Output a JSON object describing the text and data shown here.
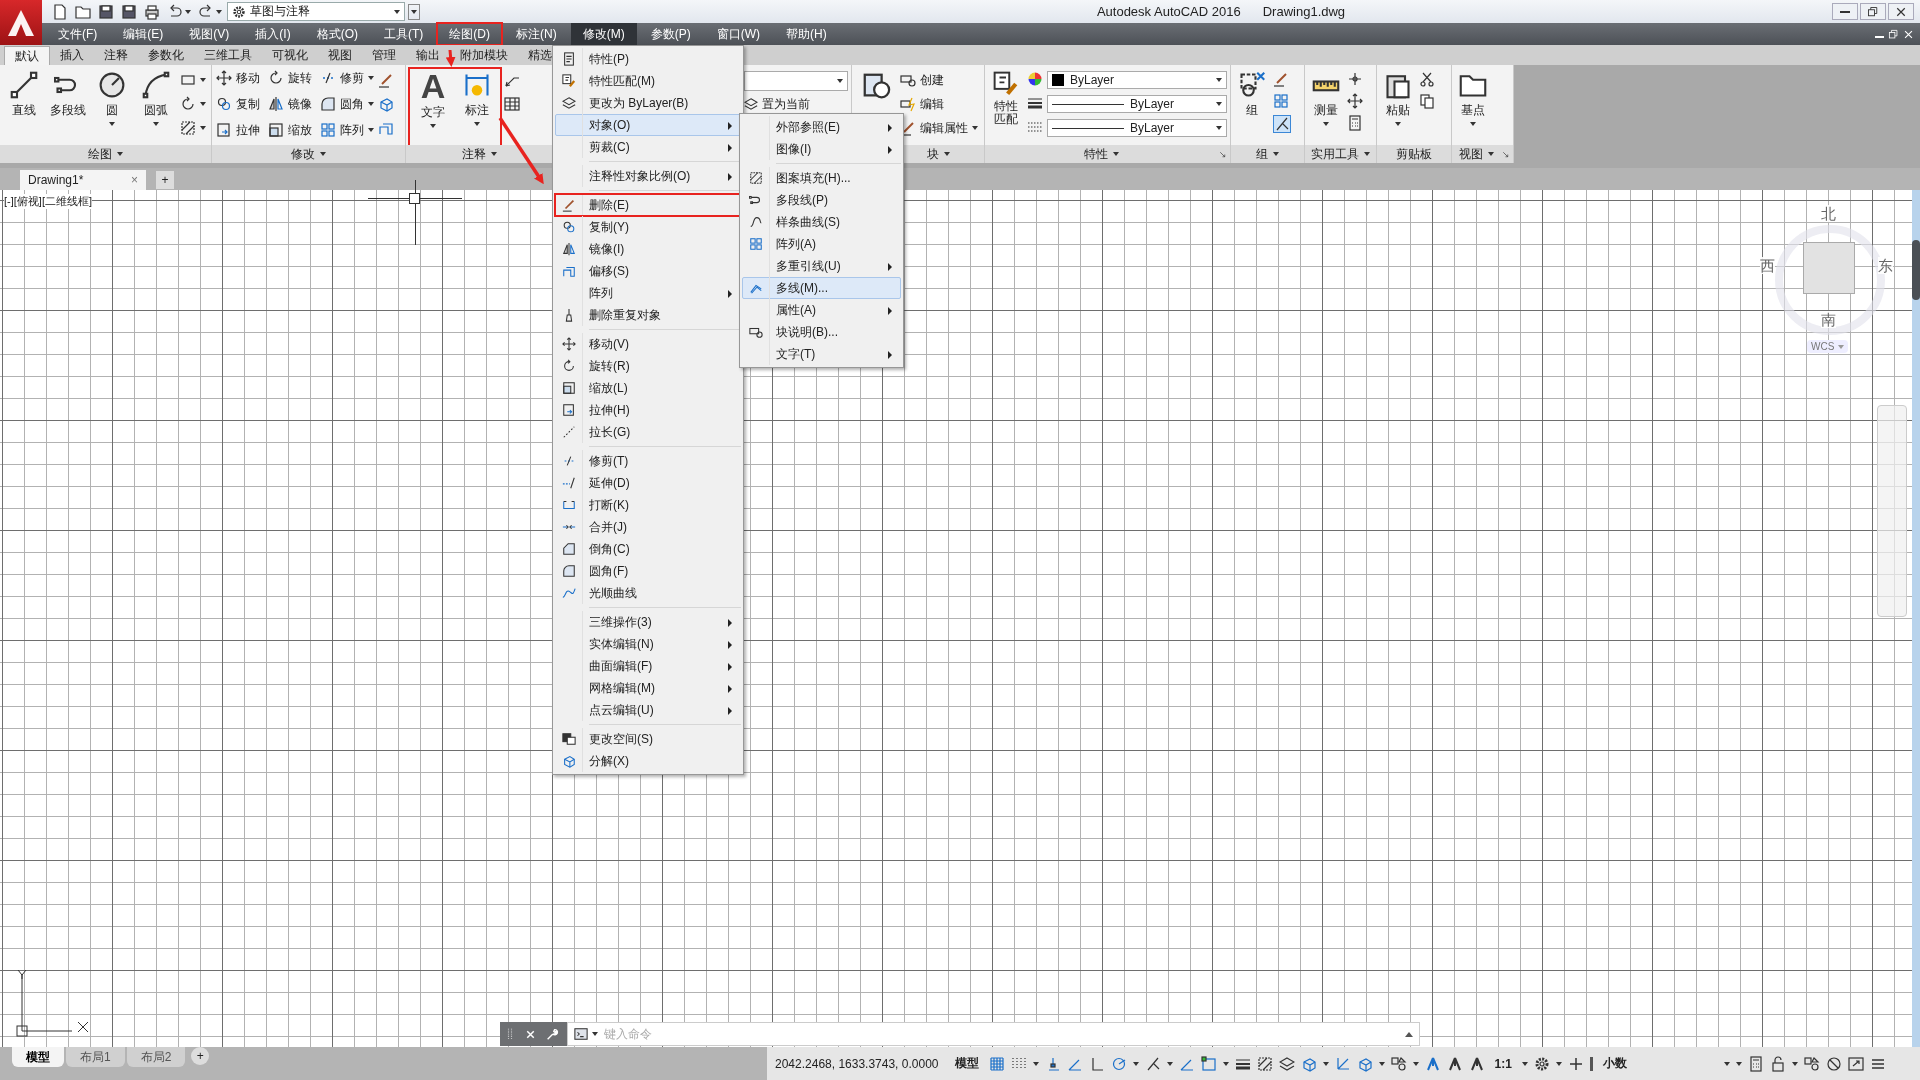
{
  "title_bar": {
    "workspace": "草图与注释",
    "app_title": "Autodesk AutoCAD 2016",
    "document": "Drawing1.dwg"
  },
  "menu_bar": [
    {
      "label": "文件(F)",
      "selected": false,
      "highlighted": false
    },
    {
      "label": "编辑(E)",
      "selected": false,
      "highlighted": false
    },
    {
      "label": "视图(V)",
      "selected": false,
      "highlighted": false
    },
    {
      "label": "插入(I)",
      "selected": false,
      "highlighted": false
    },
    {
      "label": "格式(O)",
      "selected": false,
      "highlighted": false
    },
    {
      "label": "工具(T)",
      "selected": false,
      "highlighted": false
    },
    {
      "label": "绘图(D)",
      "selected": false,
      "highlighted": true
    },
    {
      "label": "标注(N)",
      "selected": false,
      "highlighted": false
    },
    {
      "label": "修改(M)",
      "selected": true,
      "highlighted": false
    },
    {
      "label": "参数(P)",
      "selected": false,
      "highlighted": false
    },
    {
      "label": "窗口(W)",
      "selected": false,
      "highlighted": false
    },
    {
      "label": "帮助(H)",
      "selected": false,
      "highlighted": false
    }
  ],
  "ribbon_tabs": [
    {
      "label": "默认",
      "selected": true
    },
    {
      "label": "插入",
      "selected": false
    },
    {
      "label": "注释",
      "selected": false
    },
    {
      "label": "参数化",
      "selected": false
    },
    {
      "label": "三维工具",
      "selected": false
    },
    {
      "label": "可视化",
      "selected": false
    },
    {
      "label": "视图",
      "selected": false
    },
    {
      "label": "管理",
      "selected": false
    },
    {
      "label": "输出",
      "selected": false
    },
    {
      "label": "附加模块",
      "selected": false
    },
    {
      "label": "精选",
      "selected": false
    }
  ],
  "ribbon": {
    "draw": {
      "title": "绘图",
      "tools": [
        {
          "label": "直线"
        },
        {
          "label": "多段线"
        },
        {
          "label": "圆"
        },
        {
          "label": "圆弧"
        }
      ]
    },
    "modify": {
      "title": "修改",
      "tools": [
        {
          "label": "移动"
        },
        {
          "label": "旋转"
        },
        {
          "label": "修剪"
        },
        {
          "label": "复制"
        },
        {
          "label": "镜像"
        },
        {
          "label": "圆角"
        },
        {
          "label": "拉伸"
        },
        {
          "label": "缩放"
        },
        {
          "label": "阵列"
        }
      ]
    },
    "annotation": {
      "title": "注释",
      "highlighted": true,
      "tools": [
        {
          "label": "文字",
          "glyph": "A"
        },
        {
          "label": "标注"
        }
      ]
    },
    "layers": {
      "set_current": "置为当前"
    },
    "block": {
      "title": "块",
      "tools": [
        {
          "label": "创建"
        },
        {
          "label": "编辑"
        },
        {
          "label": "编辑属性"
        }
      ]
    },
    "properties": {
      "title": "特性",
      "match": "特性匹配",
      "color_label": "ByLayer",
      "lineweight_label": "ByLayer",
      "linetype_label": "ByLayer"
    },
    "groups": {
      "title": "组",
      "tool": "组"
    },
    "utilities": {
      "title": "实用工具",
      "tool": "测量"
    },
    "clipboard": {
      "title": "剪贴板",
      "tool": "粘贴"
    },
    "view": {
      "title": "视图",
      "tool": "基点"
    }
  },
  "document_tabs": [
    {
      "label": "Drawing1*",
      "selected": true,
      "close": "×"
    }
  ],
  "new_tab": "+",
  "viewport_label": "[-][俯视][二维线框]",
  "viewcube": {
    "north": "北",
    "south": "南",
    "east": "东",
    "west": "西",
    "ucs": "WCS"
  },
  "command_line": {
    "placeholder": "键入命令"
  },
  "layout_tabs": [
    {
      "label": "模型",
      "selected": true
    },
    {
      "label": "布局1",
      "selected": false
    },
    {
      "label": "布局2",
      "selected": false
    }
  ],
  "layout_add": "+",
  "status_bar": {
    "coordinates": "2042.2468, 1633.3743, 0.0000",
    "space": "模型",
    "scale": "1:1",
    "units": "小数"
  },
  "modify_menu": {
    "groups": [
      [
        {
          "label": "特性(P)",
          "submenu": false,
          "selected": false,
          "highlighted": false
        },
        {
          "label": "特性匹配(M)",
          "submenu": false,
          "selected": false,
          "highlighted": false
        },
        {
          "label": "更改为 ByLayer(B)",
          "submenu": false,
          "selected": false,
          "highlighted": false
        },
        {
          "label": "对象(O)",
          "submenu": true,
          "selected": true,
          "highlighted": false
        },
        {
          "label": "剪裁(C)",
          "submenu": true,
          "selected": false,
          "highlighted": false
        }
      ],
      [
        {
          "label": "注释性对象比例(O)",
          "submenu": true,
          "selected": false,
          "highlighted": false
        }
      ],
      [
        {
          "label": "删除(E)",
          "submenu": false,
          "selected": false,
          "highlighted": true
        },
        {
          "label": "复制(Y)",
          "submenu": false,
          "selected": false,
          "highlighted": false
        },
        {
          "label": "镜像(I)",
          "submenu": false,
          "selected": false,
          "highlighted": false
        },
        {
          "label": "偏移(S)",
          "submenu": false,
          "selected": false,
          "highlighted": false
        },
        {
          "label": "阵列",
          "submenu": true,
          "selected": false,
          "highlighted": false
        },
        {
          "label": "删除重复对象",
          "submenu": false,
          "selected": false,
          "highlighted": false
        }
      ],
      [
        {
          "label": "移动(V)",
          "submenu": false,
          "selected": false,
          "highlighted": false
        },
        {
          "label": "旋转(R)",
          "submenu": false,
          "selected": false,
          "highlighted": false
        },
        {
          "label": "缩放(L)",
          "submenu": false,
          "selected": false,
          "highlighted": false
        },
        {
          "label": "拉伸(H)",
          "submenu": false,
          "selected": false,
          "highlighted": false
        },
        {
          "label": "拉长(G)",
          "submenu": false,
          "selected": false,
          "highlighted": false
        }
      ],
      [
        {
          "label": "修剪(T)",
          "submenu": false,
          "selected": false,
          "highlighted": false
        },
        {
          "label": "延伸(D)",
          "submenu": false,
          "selected": false,
          "highlighted": false
        },
        {
          "label": "打断(K)",
          "submenu": false,
          "selected": false,
          "highlighted": false
        },
        {
          "label": "合并(J)",
          "submenu": false,
          "selected": false,
          "highlighted": false
        },
        {
          "label": "倒角(C)",
          "submenu": false,
          "selected": false,
          "highlighted": false
        },
        {
          "label": "圆角(F)",
          "submenu": false,
          "selected": false,
          "highlighted": false
        },
        {
          "label": "光顺曲线",
          "submenu": false,
          "selected": false,
          "highlighted": false
        }
      ],
      [
        {
          "label": "三维操作(3)",
          "submenu": true,
          "selected": false,
          "highlighted": false
        },
        {
          "label": "实体编辑(N)",
          "submenu": true,
          "selected": false,
          "highlighted": false
        },
        {
          "label": "曲面编辑(F)",
          "submenu": true,
          "selected": false,
          "highlighted": false
        },
        {
          "label": "网格编辑(M)",
          "submenu": true,
          "selected": false,
          "highlighted": false
        },
        {
          "label": "点云编辑(U)",
          "submenu": true,
          "selected": false,
          "highlighted": false
        }
      ],
      [
        {
          "label": "更改空间(S)",
          "submenu": false,
          "selected": false,
          "highlighted": false
        },
        {
          "label": "分解(X)",
          "submenu": false,
          "selected": false,
          "highlighted": false
        }
      ]
    ]
  },
  "object_submenu": {
    "groups": [
      [
        {
          "label": "外部参照(E)",
          "submenu": true,
          "selected": false
        },
        {
          "label": "图像(I)",
          "submenu": true,
          "selected": false
        }
      ],
      [
        {
          "label": "图案填充(H)...",
          "submenu": false,
          "selected": false
        },
        {
          "label": "多段线(P)",
          "submenu": false,
          "selected": false
        },
        {
          "label": "样条曲线(S)",
          "submenu": false,
          "selected": false
        },
        {
          "label": "阵列(A)",
          "submenu": false,
          "selected": false
        },
        {
          "label": "多重引线(U)",
          "submenu": true,
          "selected": false
        },
        {
          "label": "多线(M)...",
          "submenu": false,
          "selected": true
        },
        {
          "label": "属性(A)",
          "submenu": true,
          "selected": false
        },
        {
          "label": "块说明(B)...",
          "submenu": false,
          "selected": false
        },
        {
          "label": "文字(T)",
          "submenu": true,
          "selected": false
        }
      ]
    ]
  }
}
